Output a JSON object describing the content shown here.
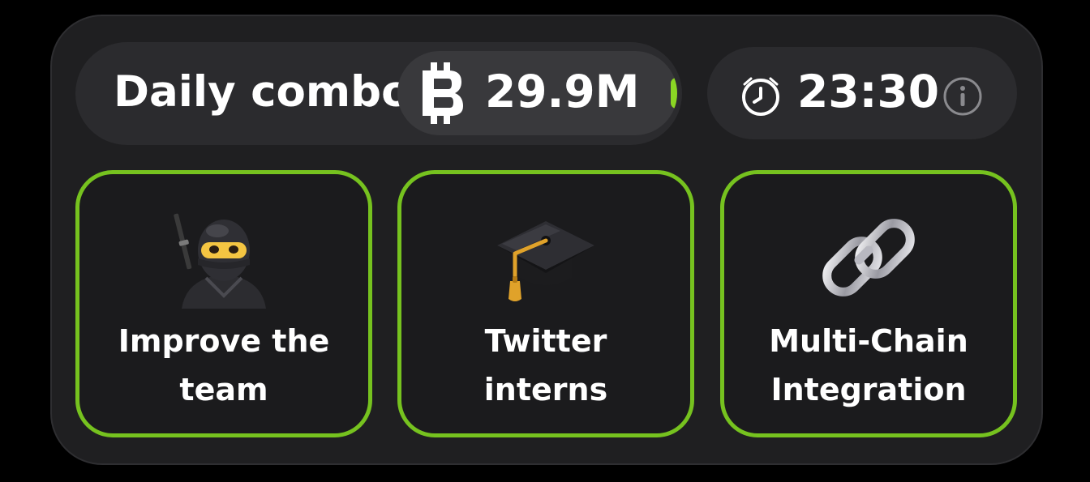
{
  "daily_combo": {
    "title": "Daily combo",
    "reward_icon": "coin-icon",
    "reward": "29.9M",
    "timer_icon": "clock-icon",
    "timer": "23:30",
    "info_icon": "info-icon"
  },
  "cards": [
    {
      "icon": "ninja-icon",
      "label_line1": "Improve the",
      "label_line2": "team"
    },
    {
      "icon": "graduation-cap-icon",
      "label_line1": "Twitter",
      "label_line2": "interns"
    },
    {
      "icon": "chain-link-icon",
      "label_line1": "Multi-Chain",
      "label_line2": "Integration"
    }
  ],
  "colors": {
    "background": "#000000",
    "panel": "#1f1f21",
    "pill": "#2b2b2e",
    "accent_green": "#76c21f",
    "text": "#ffffff"
  }
}
